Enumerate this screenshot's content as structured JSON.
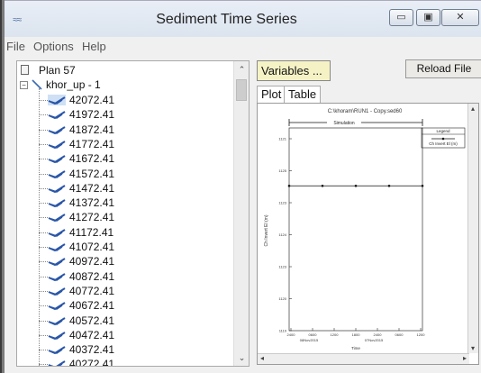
{
  "window": {
    "title": "Sediment Time Series",
    "app_icon": "hec-ras-icon",
    "buttons": {
      "minimize": "▭",
      "maximize": "▣",
      "close": "✕"
    }
  },
  "menu": [
    "File",
    "Options",
    "Help"
  ],
  "tree": {
    "plan": "Plan 57",
    "reach": "khor_up - 1",
    "stations": [
      "42072.41",
      "41972.41",
      "41872.41",
      "41772.41",
      "41672.41",
      "41572.41",
      "41472.41",
      "41372.41",
      "41272.41",
      "41172.41",
      "41072.41",
      "40972.41",
      "40872.41",
      "40772.41",
      "40672.41",
      "40572.41",
      "40472.41",
      "40372.41",
      "40272.41"
    ]
  },
  "toolbar": {
    "variables_label": "Variables ...",
    "reload_label": "Reload File"
  },
  "tabs": [
    "Plot",
    "Table"
  ],
  "chart_data": {
    "type": "line",
    "title": "C:\\khoram\\RUN1 - Copy.sed60",
    "legend": {
      "title": "Legend",
      "entries": [
        "Ch Invert El (m)"
      ],
      "position": "top-right"
    },
    "banner": "Simulation",
    "ylabel": "Ch Invert El (m)",
    "xlabel": "Time",
    "yticks": [
      "1121",
      "1125",
      "1123",
      "1124",
      "1123",
      "1120",
      "1119"
    ],
    "xticks": [
      "2400",
      "0600",
      "1200",
      "1800",
      "2400",
      "0600",
      "1200"
    ],
    "xdates": [
      "08Nov2015",
      "07Nov2015"
    ],
    "series": [
      {
        "name": "Ch Invert El (m)",
        "x": [
          0,
          1,
          2,
          3,
          4
        ],
        "y": [
          1124,
          1124,
          1124,
          1124,
          1124
        ],
        "color": "#111111"
      }
    ],
    "ylim": [
      1119,
      1126
    ]
  }
}
